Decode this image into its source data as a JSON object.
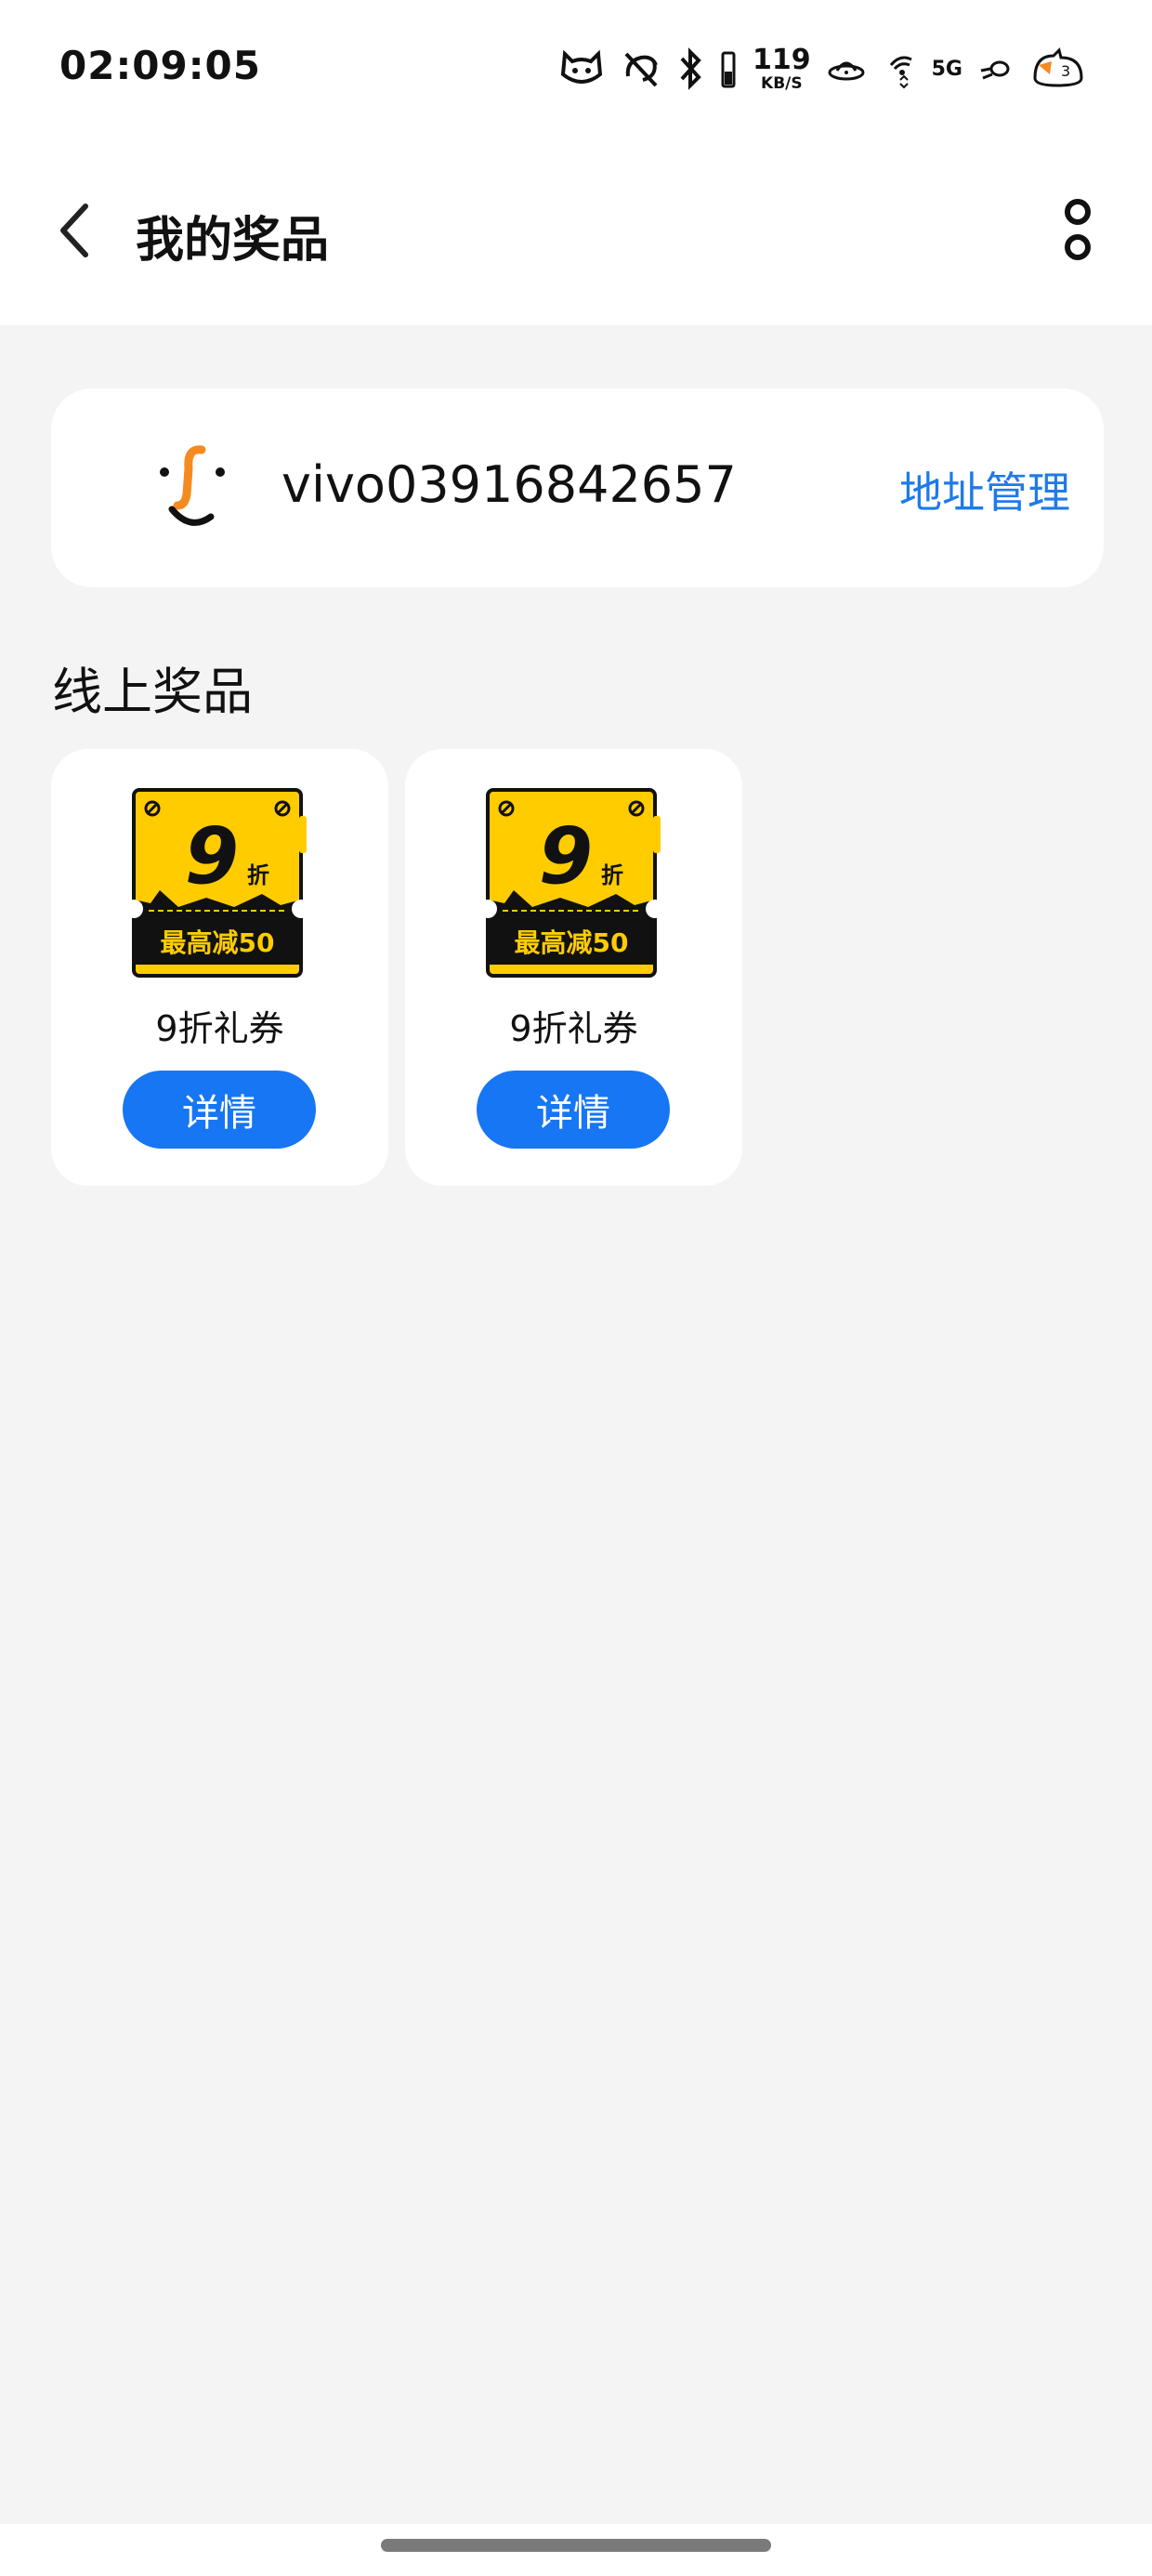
{
  "status_bar": {
    "time": "02:09:05",
    "net_speed_value": "119",
    "net_speed_unit": "KB/S",
    "network_type": "5G",
    "icons": [
      "cat-face-icon",
      "no-sync-icon",
      "bluetooth-icon",
      "battery-low-icon",
      "satellite-icon",
      "wifi-icon",
      "rocket-icon",
      "cat-sleep-icon"
    ]
  },
  "header": {
    "title": "我的奖品",
    "back_icon": "chevron-left-icon",
    "more_icon": "more-vertical-icon"
  },
  "user": {
    "username": "vivo03916842657",
    "address_link": "地址管理"
  },
  "section": {
    "title": "线上奖品"
  },
  "prizes": [
    {
      "big_digit": "9",
      "unit": "折",
      "subtitle": "最高减50",
      "name": "9折礼券",
      "button_label": "详情"
    },
    {
      "big_digit": "9",
      "unit": "折",
      "subtitle": "最高减50",
      "name": "9折礼券",
      "button_label": "详情"
    }
  ],
  "colors": {
    "accent_blue": "#1676f3",
    "link_blue": "#1e7be8",
    "coupon_yellow": "#ffcc00",
    "coupon_black": "#111111",
    "avatar_orange": "#f58a1f"
  }
}
